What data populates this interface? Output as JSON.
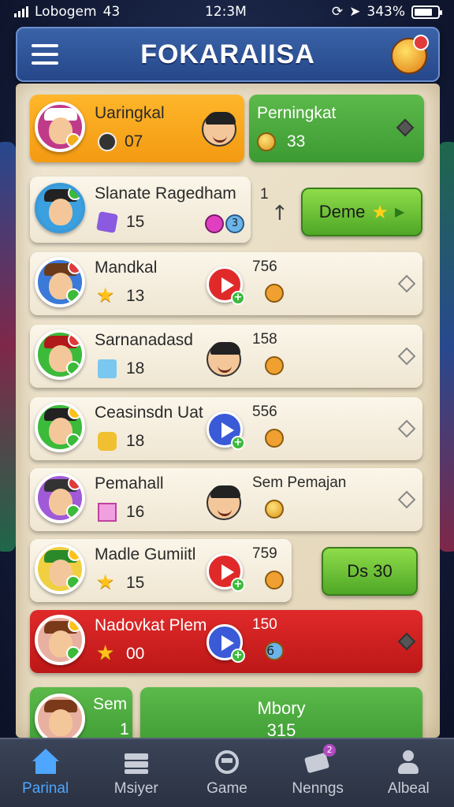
{
  "status_bar": {
    "carrier": "Lobogem",
    "network": "43",
    "time": "12:3M",
    "battery": "343%",
    "battery_level": 0.8
  },
  "header": {
    "title": "FOKARAIISA"
  },
  "top_cards": {
    "orange": {
      "name": "Uaringkal",
      "score": "07"
    },
    "green": {
      "name": "Perningkat",
      "score": "33"
    }
  },
  "players": [
    {
      "name": "Slanate Ragedham",
      "score": "15",
      "side_value": "1"
    },
    {
      "name": "Mandkal",
      "score": "13",
      "side_value": "756"
    },
    {
      "name": "Sarnanadasd",
      "score": "18",
      "side_value": "158"
    },
    {
      "name": "Ceasinsdn Uat",
      "score": "18",
      "side_value": "556"
    },
    {
      "name": "Pemahall",
      "score": "16",
      "side_value": "Sem Pemajan"
    },
    {
      "name": "Madle Gumiitl",
      "score": "15",
      "side_value": "759"
    },
    {
      "name": "Nadovkat Plem",
      "score": "00",
      "side_value": "150"
    },
    {
      "name": "Sem",
      "score": "1"
    }
  ],
  "buttons": {
    "deme": "Deme",
    "ds30": "Ds 30"
  },
  "mini_badges": {
    "row1_badge": "3",
    "row8_badge": "6"
  },
  "summary_card": {
    "title": "Mbory",
    "value": "315"
  },
  "bottom_nav": [
    {
      "label": "Parinal",
      "icon": "home-icon",
      "active": true
    },
    {
      "label": "Msiyer",
      "icon": "layers-icon",
      "active": false
    },
    {
      "label": "Game",
      "icon": "gamepad-icon",
      "active": false
    },
    {
      "label": "Nenngs",
      "icon": "tickets-icon",
      "active": false,
      "badge": "2"
    },
    {
      "label": "Albeal",
      "icon": "profile-icon",
      "active": false
    }
  ]
}
